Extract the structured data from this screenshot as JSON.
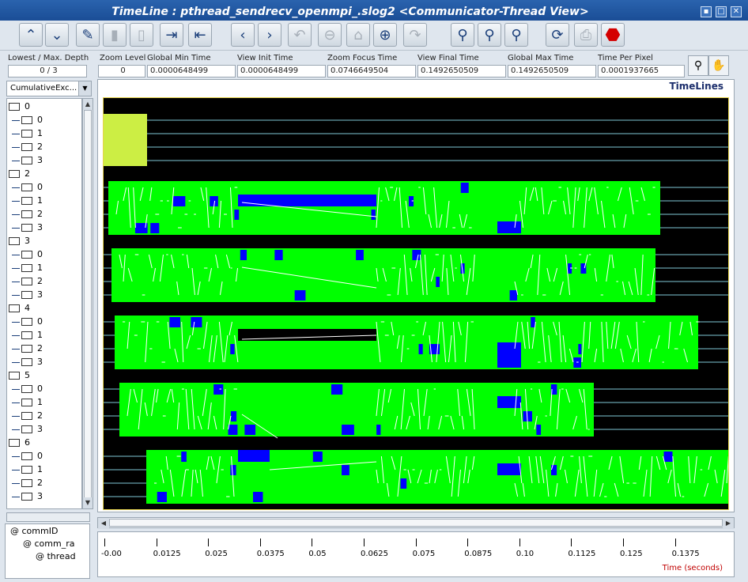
{
  "window": {
    "title": "TimeLine : pthread_sendrecv_openmpi_.slog2  <Communicator-Thread View>"
  },
  "toolbar": {
    "buttons": [
      {
        "name": "scroll-up-button",
        "icon": "up-chevron-icon",
        "glyph": "⌃",
        "enabled": true
      },
      {
        "name": "scroll-down-button",
        "icon": "down-chevron-icon",
        "glyph": "⌄",
        "enabled": true
      },
      {
        "name": "edit-button",
        "icon": "pencil-icon",
        "glyph": "✎",
        "enabled": true
      },
      {
        "name": "paste-button",
        "icon": "clipboard-icon",
        "glyph": "▮",
        "enabled": false
      },
      {
        "name": "delete-button",
        "icon": "trash-icon",
        "glyph": "▯",
        "enabled": false
      },
      {
        "name": "expand-button",
        "icon": "expand-right-icon",
        "glyph": "⇥",
        "enabled": true
      },
      {
        "name": "collapse-button",
        "icon": "collapse-left-icon",
        "glyph": "⇤",
        "enabled": true
      },
      {
        "name": "scroll-left-button",
        "icon": "left-chevron-icon",
        "glyph": "‹",
        "enabled": true
      },
      {
        "name": "scroll-right-button",
        "icon": "right-chevron-icon",
        "glyph": "›",
        "enabled": true
      },
      {
        "name": "undo-zoom-button",
        "icon": "undo-icon",
        "glyph": "↶",
        "enabled": false
      },
      {
        "name": "zoom-out-button",
        "icon": "zoom-out-icon",
        "glyph": "⊖",
        "enabled": false
      },
      {
        "name": "home-button",
        "icon": "home-icon",
        "glyph": "⌂",
        "enabled": false
      },
      {
        "name": "zoom-in-button",
        "icon": "zoom-in-icon",
        "glyph": "⊕",
        "enabled": true
      },
      {
        "name": "redo-zoom-button",
        "icon": "redo-icon",
        "glyph": "↷",
        "enabled": false
      },
      {
        "name": "search-backward-button",
        "icon": "binoculars-left-icon",
        "glyph": "⚲",
        "enabled": true
      },
      {
        "name": "search-init-button",
        "icon": "binoculars-icon",
        "glyph": "⚲",
        "enabled": true
      },
      {
        "name": "search-forward-button",
        "icon": "binoculars-right-icon",
        "glyph": "⚲",
        "enabled": true
      },
      {
        "name": "refresh-button",
        "icon": "refresh-icon",
        "glyph": "⟳",
        "enabled": true
      },
      {
        "name": "print-button",
        "icon": "printer-icon",
        "glyph": "⎙",
        "enabled": false
      },
      {
        "name": "stop-button",
        "icon": "stop-icon",
        "glyph": "⬣",
        "enabled": true
      }
    ]
  },
  "fields": {
    "depth": {
      "label": "Lowest / Max. Depth",
      "value": "0 / 3"
    },
    "zoom_level": {
      "label": "Zoom Level",
      "value": "0"
    },
    "global_min": {
      "label": "Global Min Time",
      "value": "0.0000648499"
    },
    "view_init": {
      "label": "View  Init Time",
      "value": "0.0000648499"
    },
    "zoom_focus": {
      "label": "Zoom Focus Time",
      "value": "0.0746649504"
    },
    "view_final": {
      "label": "View Final Time",
      "value": "0.1492650509"
    },
    "global_max": {
      "label": "Global Max Time",
      "value": "0.1492650509"
    },
    "time_per_pixel": {
      "label": "Time Per Pixel",
      "value": "0.0001937665"
    }
  },
  "left": {
    "combo_value": "CumulativeExc...",
    "tree": [
      {
        "label": "0",
        "children": [
          "0",
          "1",
          "2",
          "3"
        ]
      },
      {
        "label": "2",
        "children": [
          "0",
          "1",
          "2",
          "3"
        ]
      },
      {
        "label": "3",
        "children": [
          "0",
          "1",
          "2",
          "3"
        ]
      },
      {
        "label": "4",
        "children": [
          "0",
          "1",
          "2",
          "3"
        ]
      },
      {
        "label": "5",
        "children": [
          "0",
          "1",
          "2",
          "3"
        ]
      },
      {
        "label": "6",
        "children": [
          "0",
          "1",
          "2",
          "3"
        ]
      }
    ],
    "legend": [
      "@ commID",
      "@ comm_ra",
      "@ thread"
    ]
  },
  "canvas": {
    "panel_label": "TimeLines"
  },
  "ruler": {
    "ticks": [
      "-0.00",
      "0.0125",
      "0.025",
      "0.0375",
      "0.05",
      "0.0625",
      "0.075",
      "0.0875",
      "0.10",
      "0.1125",
      "0.125",
      "0.1375"
    ],
    "axis_label": "Time (seconds)"
  },
  "colors": {
    "state_green": "#00ff00",
    "state_blue": "#0000ff",
    "state_yellow": "#ccee44",
    "timeline_line": "#7fc8d6",
    "arrow": "#ffffff",
    "background": "#000000",
    "stop_red": "#d40000"
  }
}
